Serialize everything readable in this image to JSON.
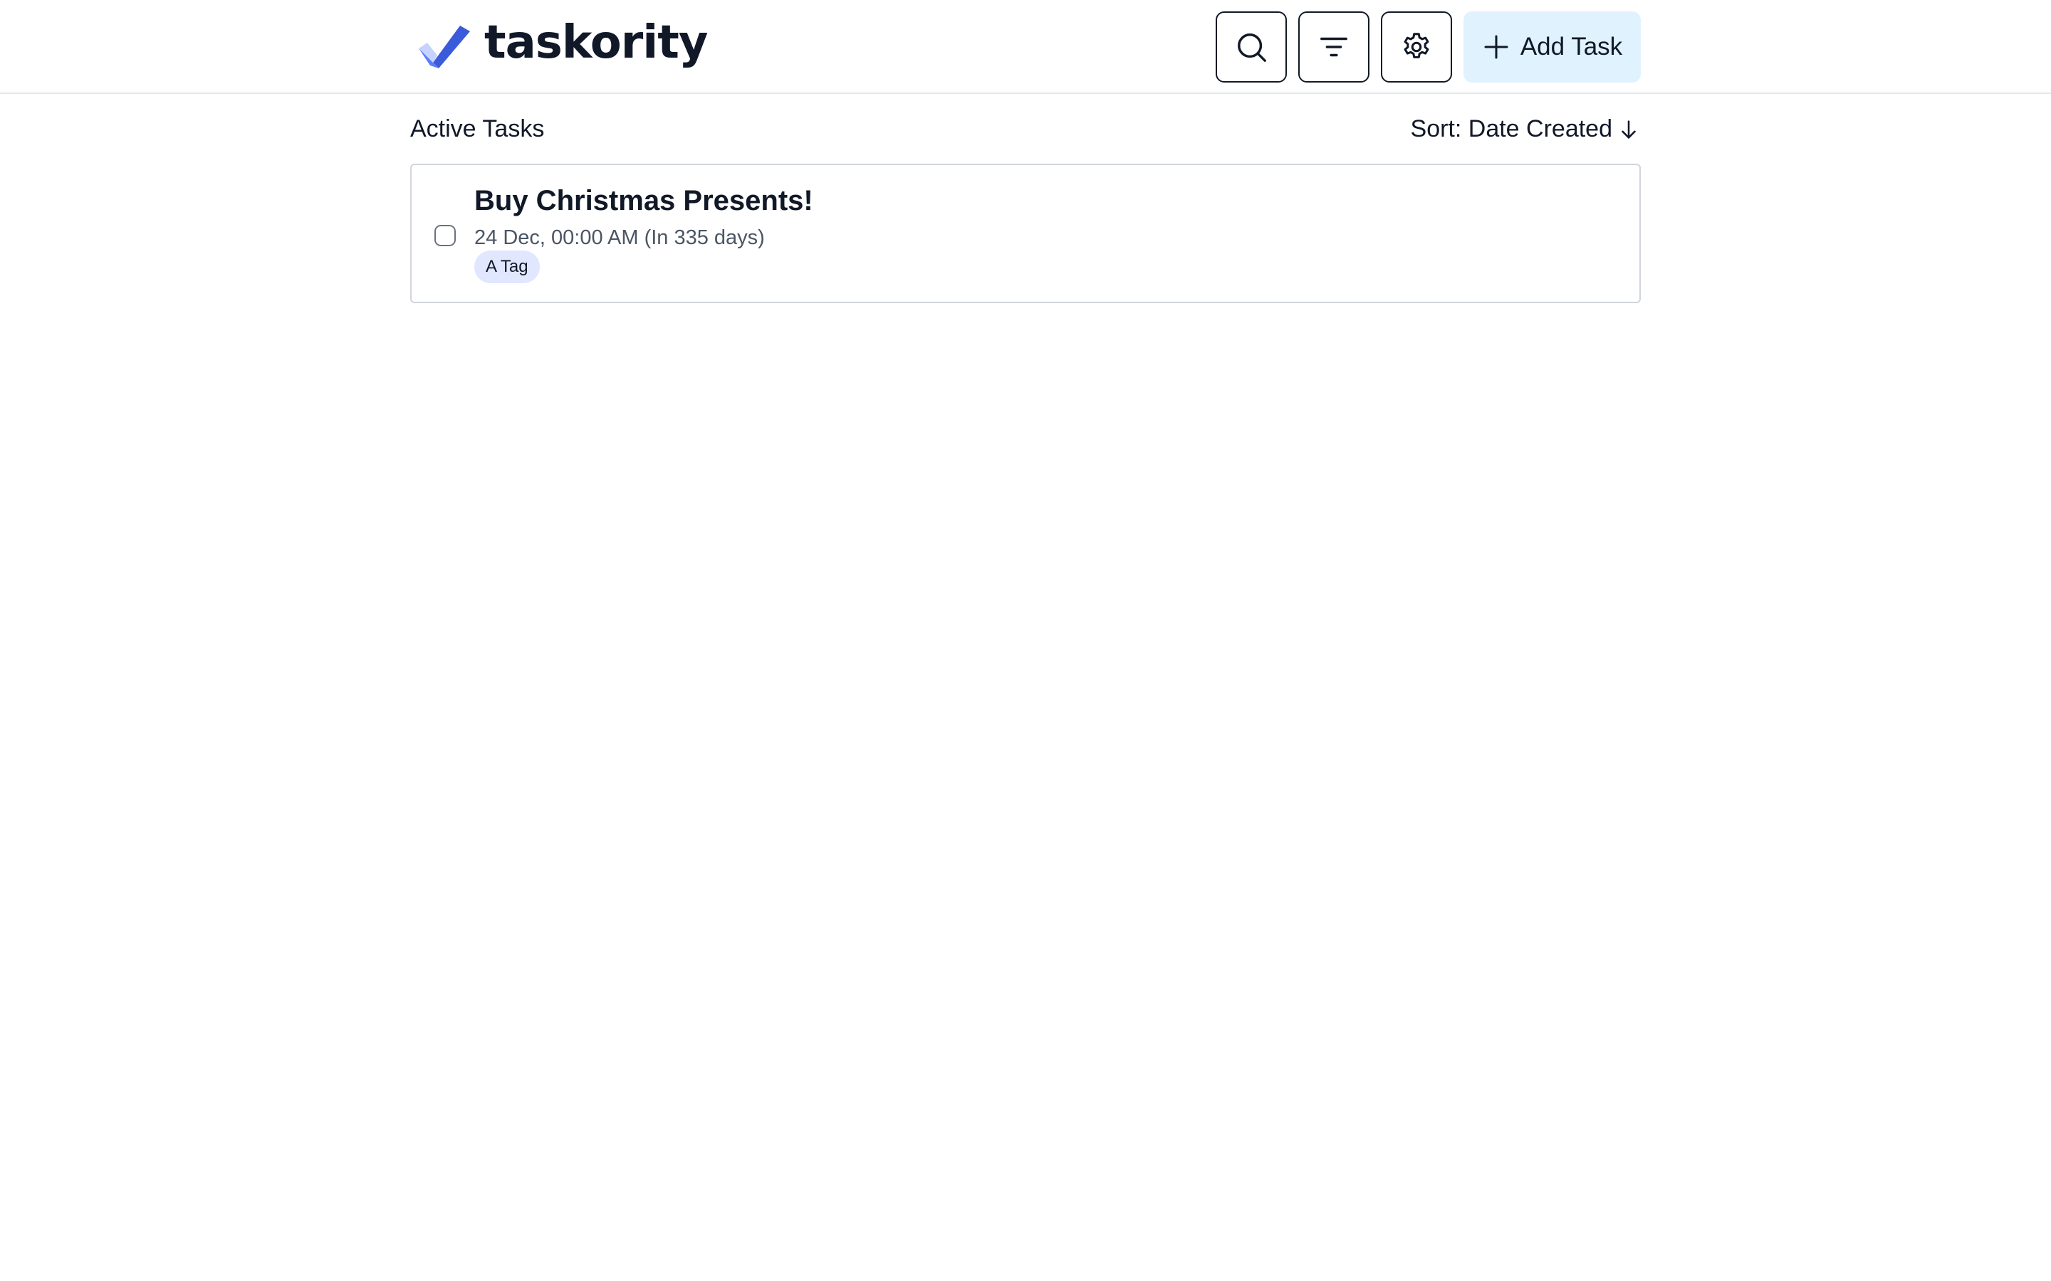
{
  "app": {
    "brand": "taskority",
    "accent_color": "#3b5bdb"
  },
  "header": {
    "search_icon": "search-icon",
    "filter_icon": "filter-icon",
    "settings_icon": "gear-icon",
    "add_task_label": "Add Task",
    "add_task_icon": "plus-icon",
    "add_task_bg": "#e0f2fe"
  },
  "main": {
    "section_title": "Active Tasks",
    "sort_label": "Sort: Date Created",
    "sort_icon": "arrow-down-icon",
    "tasks": [
      {
        "title": "Buy Christmas Presents!",
        "due": "24 Dec, 00:00 AM (In 335 days)",
        "completed": false,
        "tags": [
          "A Tag"
        ]
      }
    ]
  }
}
